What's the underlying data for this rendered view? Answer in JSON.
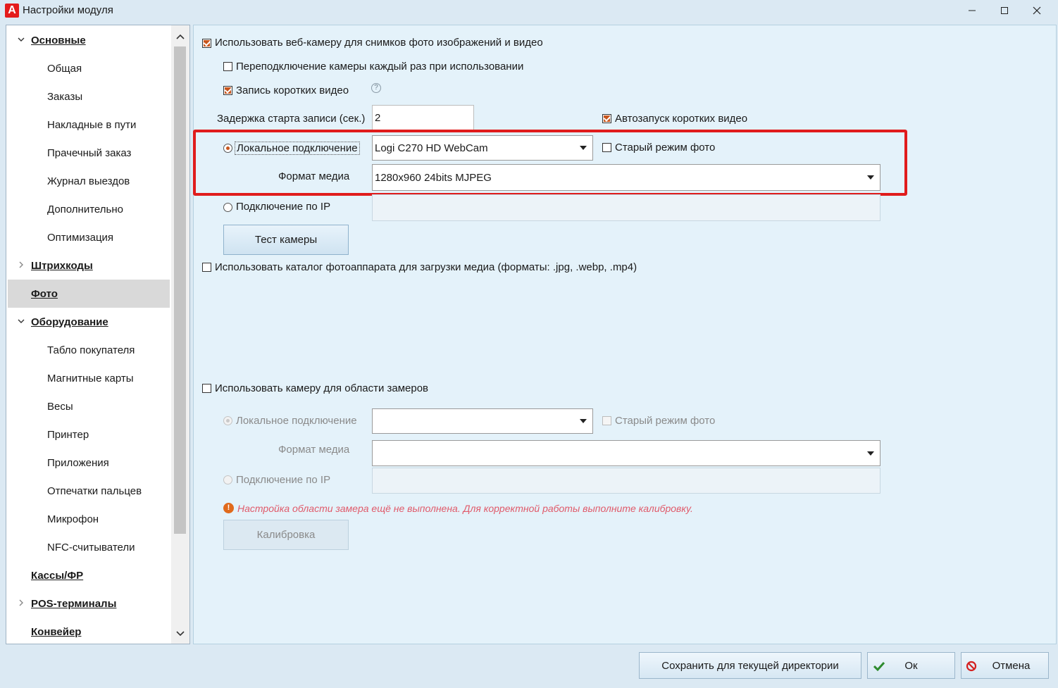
{
  "window": {
    "title": "Настройки модуля",
    "logo": "А"
  },
  "sidebar": {
    "items": [
      {
        "label": "Основные",
        "type": "group",
        "expanded": true
      },
      {
        "label": "Общая",
        "type": "child"
      },
      {
        "label": "Заказы",
        "type": "child"
      },
      {
        "label": "Накладные в пути",
        "type": "child"
      },
      {
        "label": "Прачечный заказ",
        "type": "child"
      },
      {
        "label": "Журнал выездов",
        "type": "child"
      },
      {
        "label": "Дополнительно",
        "type": "child"
      },
      {
        "label": "Оптимизация",
        "type": "child"
      },
      {
        "label": "Штрихкоды",
        "type": "group",
        "expanded": false
      },
      {
        "label": "Фото",
        "type": "group",
        "selected": true
      },
      {
        "label": "Оборудование",
        "type": "group",
        "expanded": true
      },
      {
        "label": "Табло покупателя",
        "type": "child"
      },
      {
        "label": "Магнитные карты",
        "type": "child"
      },
      {
        "label": "Весы",
        "type": "child"
      },
      {
        "label": "Принтер",
        "type": "child"
      },
      {
        "label": "Приложения",
        "type": "child"
      },
      {
        "label": "Отпечатки пальцев",
        "type": "child"
      },
      {
        "label": "Микрофон",
        "type": "child"
      },
      {
        "label": "NFC-считыватели",
        "type": "child"
      },
      {
        "label": "Кассы/ФР",
        "type": "group"
      },
      {
        "label": "POS-терминалы",
        "type": "group",
        "expanded": false
      },
      {
        "label": "Конвейер",
        "type": "group"
      }
    ]
  },
  "webcam": {
    "use_webcam_label": "Использовать веб-камеру для снимков фото изображений и видео",
    "use_webcam_checked": true,
    "reconnect_label": "Переподключение камеры каждый раз при использовании",
    "reconnect_checked": false,
    "record_short_label": "Запись коротких видео",
    "record_short_checked": true,
    "delay_label": "Задержка старта записи (сек.)",
    "delay_value": "2",
    "autostart_label": "Автозапуск коротких видео",
    "autostart_checked": true,
    "local_label": "Локальное подключение",
    "local_selected": true,
    "camera_value": "Logi C270 HD WebCam",
    "old_photo_label": "Старый режим фото",
    "old_photo_checked": false,
    "media_format_label": "Формат медиа",
    "media_format_value": "1280x960 24bits MJPEG",
    "ip_label": "Подключение по IP",
    "ip_value": "",
    "test_button": "Тест камеры"
  },
  "catalog": {
    "label": "Использовать каталог фотоаппарата для загрузки медиа (форматы: .jpg, .webp, .mp4)",
    "checked": false
  },
  "measure": {
    "use_label": "Использовать камеру для области замеров",
    "use_checked": false,
    "local_label": "Локальное подключение",
    "camera_value": "",
    "old_photo_label": "Старый режим фото",
    "media_format_label": "Формат медиа",
    "media_format_value": "",
    "ip_label": "Подключение по IP",
    "warning": "Настройка области замера ещё не выполнена. Для корректной работы выполните калибровку.",
    "calibrate_button": "Калибровка"
  },
  "footer": {
    "save_label": "Сохранить для текущей директории",
    "ok_label": "Ок",
    "cancel_label": "Отмена"
  },
  "colors": {
    "accent": "#c8551c",
    "highlight": "#e01c1c",
    "warning": "#e05a6a",
    "ok_icon": "#2e8b2e",
    "cancel_icon": "#d42020"
  }
}
